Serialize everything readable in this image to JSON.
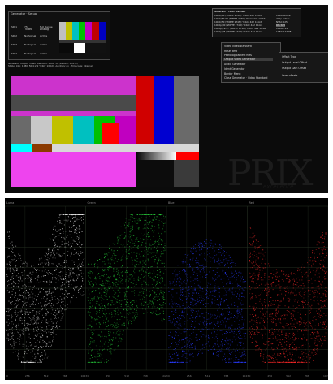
{
  "generator": {
    "title": "Generator · Setup",
    "headers": [
      "",
      "Video",
      "Analog"
    ],
    "rows": [
      {
        "a": "SDI1",
        "b": "75",
        "c": "Full Range"
      },
      {
        "a": "SDI2",
        "b": "No Signal",
        "c": "Active"
      },
      {
        "a": "SDI3",
        "b": "No Signal",
        "c": "Active"
      },
      {
        "a": "SDI4",
        "b": "No Signal",
        "c": "Active"
      }
    ]
  },
  "note_lines": [
    "Generator output: Video Standard: 1080i 50 (Pattern: SMPTE)",
    "Status Info: 1080i 50 4:2:2 YCbCr 10-bit · Ancillary on · Timecode: Internal"
  ],
  "popup": {
    "title": "Generator · Video Standard",
    "lines": [
      "1080i/60 (SMPTE 274M) YCbCr 422 10-bit",
      "1080i/59.94 (SMPTE 274M) YCbCr 422 10-bit",
      "1080i/50 (SMPTE 274M) YCbCr 422 10-bit",
      "1080p/30 (SMPTE 274M) YCbCr 422 10-bit",
      "1080p/29.97 (SMPTE 274M) YCbCr 422 10-bit",
      "1080p/25 (SMPTE 274M) YCbCr 422 10-bit"
    ],
    "right_lines": [
      "1080i Active",
      "720p Active",
      "NTSC 525",
      "PAL 625",
      "1080sf 24",
      "1080sf 23.98"
    ]
  },
  "context_menu": {
    "items": [
      "Video video standard",
      "Reset test",
      "Pathological test files",
      "Output Video Generator",
      "Audio Generator",
      "Ident Generator",
      "Border Menu",
      "Close Generator · Video Standard"
    ],
    "highlighted_index": 3,
    "submenu": [
      "Offset Type",
      "Output Level Offset",
      "Output Gain Offset",
      "Over offsets"
    ]
  },
  "watermark": {
    "main": "PRIX",
    "sub": "excellence"
  },
  "waveform": {
    "channels": [
      {
        "name": "Luma",
        "color": "#e8e8e8"
      },
      {
        "name": "Green",
        "color": "#28d23c"
      },
      {
        "name": "Blue",
        "color": "#2a3cff"
      },
      {
        "name": "Red",
        "color": "#ff2a2a"
      }
    ],
    "tick_labels": [
      "0",
      "128",
      "256",
      "384",
      "512",
      "640",
      "768",
      "896",
      "1023"
    ]
  },
  "colors": {
    "window_bg": "#0b0b0b",
    "scope_bg": "#000000",
    "graticule": "#2e3a2a"
  }
}
